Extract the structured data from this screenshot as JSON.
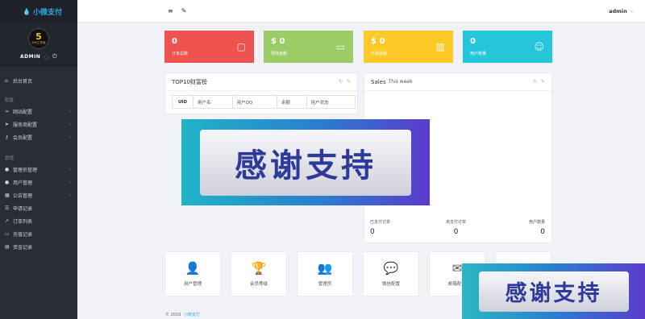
{
  "brand": {
    "title": "小微支付"
  },
  "profile": {
    "badge_number": "5",
    "badge_text": "500工作室",
    "name": "ADMIN"
  },
  "sidebar": {
    "items_top": [
      {
        "label": "后台首页",
        "icon": "home-icon"
      }
    ],
    "section1": "配置",
    "items_config": [
      {
        "label": "网站配置",
        "icon": "link-icon"
      },
      {
        "label": "服务商配置",
        "icon": "send-icon"
      },
      {
        "label": "会员配置",
        "icon": "key-icon"
      }
    ],
    "section2": "管理",
    "items_manage": [
      {
        "label": "管理员管理",
        "icon": "user-icon"
      },
      {
        "label": "用户管理",
        "icon": "users-icon"
      },
      {
        "label": "公告管理",
        "icon": "grid-icon"
      },
      {
        "label": "申请记录",
        "icon": "list-icon"
      },
      {
        "label": "订单列表",
        "icon": "chart-icon"
      },
      {
        "label": "充值记录",
        "icon": "card-icon"
      },
      {
        "label": "资金记录",
        "icon": "table-icon"
      }
    ]
  },
  "topbar": {
    "user": "admin"
  },
  "stats": [
    {
      "value": "0",
      "caption": "订单总数",
      "color": "#ef5350",
      "icon": "clipboard-icon"
    },
    {
      "value": "$ 0",
      "caption": "预存金额",
      "color": "#9ccc65",
      "icon": "folder-icon"
    },
    {
      "value": "$ 0",
      "caption": "交易总额",
      "color": "#ffca28",
      "icon": "bar-chart-icon"
    },
    {
      "value": "0",
      "caption": "用户数量",
      "color": "#26c6da",
      "icon": "user-add-icon"
    }
  ],
  "top10": {
    "title": "TOP10财富榜",
    "columns": [
      "UID",
      "用户名",
      "用户QQ",
      "余额",
      "用户状态"
    ]
  },
  "sales": {
    "title": "Sales",
    "subtitle": "This week",
    "stats": [
      {
        "label": "已支付订单",
        "value": "0"
      },
      {
        "label": "未支付订单",
        "value": "0"
      },
      {
        "label": "用户数量",
        "value": "0"
      }
    ]
  },
  "shortcuts": [
    {
      "label": "用户管理",
      "icon": "user-icon"
    },
    {
      "label": "会员等级",
      "icon": "trophy-icon"
    },
    {
      "label": "管理员",
      "icon": "users-icon"
    },
    {
      "label": "微信配置",
      "icon": "chat-icon"
    },
    {
      "label": "邮箱配置",
      "icon": "mail-icon"
    },
    {
      "label": "",
      "icon": "settings-icon"
    }
  ],
  "banner_text": "感谢支持",
  "footer": {
    "copy": "© 2019",
    "link": "小微支付"
  }
}
